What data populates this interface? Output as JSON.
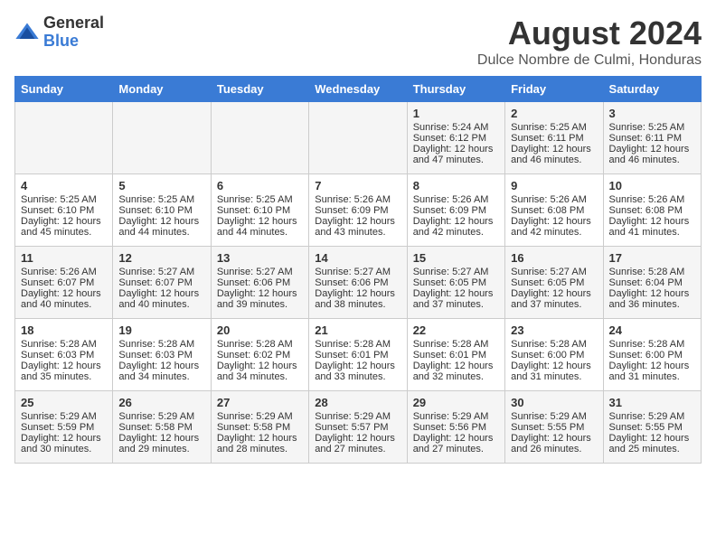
{
  "header": {
    "logo_general": "General",
    "logo_blue": "Blue",
    "main_title": "August 2024",
    "subtitle": "Dulce Nombre de Culmi, Honduras"
  },
  "days_of_week": [
    "Sunday",
    "Monday",
    "Tuesday",
    "Wednesday",
    "Thursday",
    "Friday",
    "Saturday"
  ],
  "weeks": [
    [
      {
        "day": "",
        "content": ""
      },
      {
        "day": "",
        "content": ""
      },
      {
        "day": "",
        "content": ""
      },
      {
        "day": "",
        "content": ""
      },
      {
        "day": "1",
        "content": "Sunrise: 5:24 AM\nSunset: 6:12 PM\nDaylight: 12 hours\nand 47 minutes."
      },
      {
        "day": "2",
        "content": "Sunrise: 5:25 AM\nSunset: 6:11 PM\nDaylight: 12 hours\nand 46 minutes."
      },
      {
        "day": "3",
        "content": "Sunrise: 5:25 AM\nSunset: 6:11 PM\nDaylight: 12 hours\nand 46 minutes."
      }
    ],
    [
      {
        "day": "4",
        "content": "Sunrise: 5:25 AM\nSunset: 6:10 PM\nDaylight: 12 hours\nand 45 minutes."
      },
      {
        "day": "5",
        "content": "Sunrise: 5:25 AM\nSunset: 6:10 PM\nDaylight: 12 hours\nand 44 minutes."
      },
      {
        "day": "6",
        "content": "Sunrise: 5:25 AM\nSunset: 6:10 PM\nDaylight: 12 hours\nand 44 minutes."
      },
      {
        "day": "7",
        "content": "Sunrise: 5:26 AM\nSunset: 6:09 PM\nDaylight: 12 hours\nand 43 minutes."
      },
      {
        "day": "8",
        "content": "Sunrise: 5:26 AM\nSunset: 6:09 PM\nDaylight: 12 hours\nand 42 minutes."
      },
      {
        "day": "9",
        "content": "Sunrise: 5:26 AM\nSunset: 6:08 PM\nDaylight: 12 hours\nand 42 minutes."
      },
      {
        "day": "10",
        "content": "Sunrise: 5:26 AM\nSunset: 6:08 PM\nDaylight: 12 hours\nand 41 minutes."
      }
    ],
    [
      {
        "day": "11",
        "content": "Sunrise: 5:26 AM\nSunset: 6:07 PM\nDaylight: 12 hours\nand 40 minutes."
      },
      {
        "day": "12",
        "content": "Sunrise: 5:27 AM\nSunset: 6:07 PM\nDaylight: 12 hours\nand 40 minutes."
      },
      {
        "day": "13",
        "content": "Sunrise: 5:27 AM\nSunset: 6:06 PM\nDaylight: 12 hours\nand 39 minutes."
      },
      {
        "day": "14",
        "content": "Sunrise: 5:27 AM\nSunset: 6:06 PM\nDaylight: 12 hours\nand 38 minutes."
      },
      {
        "day": "15",
        "content": "Sunrise: 5:27 AM\nSunset: 6:05 PM\nDaylight: 12 hours\nand 37 minutes."
      },
      {
        "day": "16",
        "content": "Sunrise: 5:27 AM\nSunset: 6:05 PM\nDaylight: 12 hours\nand 37 minutes."
      },
      {
        "day": "17",
        "content": "Sunrise: 5:28 AM\nSunset: 6:04 PM\nDaylight: 12 hours\nand 36 minutes."
      }
    ],
    [
      {
        "day": "18",
        "content": "Sunrise: 5:28 AM\nSunset: 6:03 PM\nDaylight: 12 hours\nand 35 minutes."
      },
      {
        "day": "19",
        "content": "Sunrise: 5:28 AM\nSunset: 6:03 PM\nDaylight: 12 hours\nand 34 minutes."
      },
      {
        "day": "20",
        "content": "Sunrise: 5:28 AM\nSunset: 6:02 PM\nDaylight: 12 hours\nand 34 minutes."
      },
      {
        "day": "21",
        "content": "Sunrise: 5:28 AM\nSunset: 6:01 PM\nDaylight: 12 hours\nand 33 minutes."
      },
      {
        "day": "22",
        "content": "Sunrise: 5:28 AM\nSunset: 6:01 PM\nDaylight: 12 hours\nand 32 minutes."
      },
      {
        "day": "23",
        "content": "Sunrise: 5:28 AM\nSunset: 6:00 PM\nDaylight: 12 hours\nand 31 minutes."
      },
      {
        "day": "24",
        "content": "Sunrise: 5:28 AM\nSunset: 6:00 PM\nDaylight: 12 hours\nand 31 minutes."
      }
    ],
    [
      {
        "day": "25",
        "content": "Sunrise: 5:29 AM\nSunset: 5:59 PM\nDaylight: 12 hours\nand 30 minutes."
      },
      {
        "day": "26",
        "content": "Sunrise: 5:29 AM\nSunset: 5:58 PM\nDaylight: 12 hours\nand 29 minutes."
      },
      {
        "day": "27",
        "content": "Sunrise: 5:29 AM\nSunset: 5:58 PM\nDaylight: 12 hours\nand 28 minutes."
      },
      {
        "day": "28",
        "content": "Sunrise: 5:29 AM\nSunset: 5:57 PM\nDaylight: 12 hours\nand 27 minutes."
      },
      {
        "day": "29",
        "content": "Sunrise: 5:29 AM\nSunset: 5:56 PM\nDaylight: 12 hours\nand 27 minutes."
      },
      {
        "day": "30",
        "content": "Sunrise: 5:29 AM\nSunset: 5:55 PM\nDaylight: 12 hours\nand 26 minutes."
      },
      {
        "day": "31",
        "content": "Sunrise: 5:29 AM\nSunset: 5:55 PM\nDaylight: 12 hours\nand 25 minutes."
      }
    ]
  ]
}
